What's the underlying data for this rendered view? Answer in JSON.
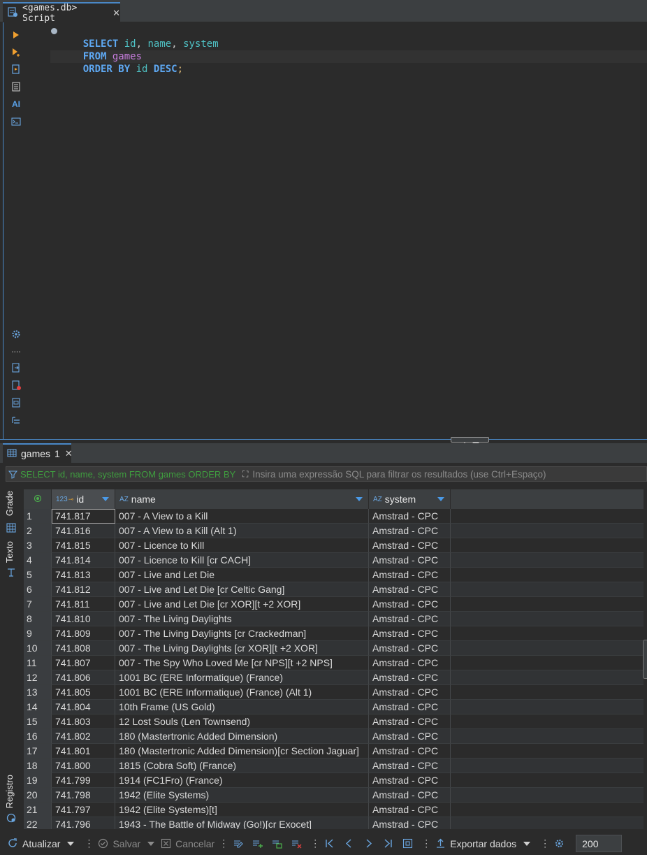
{
  "editor": {
    "tab_label": "<games.db> Script",
    "sql": {
      "line1": {
        "kw1": "SELECT",
        "id": "id",
        "c1": ",",
        "name": "name",
        "c2": ",",
        "system": "system"
      },
      "line2": {
        "kw": "FROM",
        "table": "games"
      },
      "line3": {
        "kw1": "ORDER BY",
        "col": "id",
        "kw2": "DESC",
        "semi": ";"
      }
    },
    "gutter_top_icons": [
      "execute-statement-icon",
      "execute-statement-new-tab-icon",
      "execute-script-icon",
      "explain-plan-icon",
      "ai-assistant-icon",
      "sql-console-icon"
    ],
    "gutter_ai_label": "AI",
    "gutter_bottom_icons": [
      "settings-gear-icon",
      "more-dots-icon",
      "export-script-icon",
      "script-error-icon",
      "sql-file-icon",
      "outline-icon"
    ],
    "gutter_dots": "...."
  },
  "results": {
    "tab_label": "games",
    "tab_count": "1",
    "filter_query": "SELECT id, name, system FROM games ORDER BY id DESC",
    "filter_placeholder": "Insira uma expressão SQL para filtrar os resultados (use Ctrl+Espaço)",
    "side_tabs": {
      "grid": "Grade",
      "text": "Texto",
      "log": "Registro"
    },
    "columns": [
      {
        "type": "123",
        "label": "id"
      },
      {
        "type": "AZ",
        "label": "name"
      },
      {
        "type": "AZ",
        "label": "system"
      }
    ],
    "rows": [
      {
        "n": "1",
        "id": "741.817",
        "name": "007 - A View to a Kill",
        "system": "Amstrad - CPC"
      },
      {
        "n": "2",
        "id": "741.816",
        "name": "007 - A View to a Kill (Alt 1)",
        "system": "Amstrad - CPC"
      },
      {
        "n": "3",
        "id": "741.815",
        "name": "007 - Licence to Kill",
        "system": "Amstrad - CPC"
      },
      {
        "n": "4",
        "id": "741.814",
        "name": "007 - Licence to Kill [cr CACH]",
        "system": "Amstrad - CPC"
      },
      {
        "n": "5",
        "id": "741.813",
        "name": "007 - Live and Let Die",
        "system": "Amstrad - CPC"
      },
      {
        "n": "6",
        "id": "741.812",
        "name": "007 - Live and Let Die [cr Celtic Gang]",
        "system": "Amstrad - CPC"
      },
      {
        "n": "7",
        "id": "741.811",
        "name": "007 - Live and Let Die [cr XOR][t +2 XOR]",
        "system": "Amstrad - CPC"
      },
      {
        "n": "8",
        "id": "741.810",
        "name": "007 - The Living Daylights",
        "system": "Amstrad - CPC"
      },
      {
        "n": "9",
        "id": "741.809",
        "name": "007 - The Living Daylights [cr Crackedman]",
        "system": "Amstrad - CPC"
      },
      {
        "n": "10",
        "id": "741.808",
        "name": "007 - The Living Daylights [cr XOR][t +2 XOR]",
        "system": "Amstrad - CPC"
      },
      {
        "n": "11",
        "id": "741.807",
        "name": "007 - The Spy Who Loved Me [cr NPS][t +2 NPS]",
        "system": "Amstrad - CPC"
      },
      {
        "n": "12",
        "id": "741.806",
        "name": "1001 BC (ERE Informatique) (France)",
        "system": "Amstrad - CPC"
      },
      {
        "n": "13",
        "id": "741.805",
        "name": "1001 BC (ERE Informatique) (France) (Alt 1)",
        "system": "Amstrad - CPC"
      },
      {
        "n": "14",
        "id": "741.804",
        "name": "10th Frame (US Gold)",
        "system": "Amstrad - CPC"
      },
      {
        "n": "15",
        "id": "741.803",
        "name": "12 Lost Souls (Len Townsend)",
        "system": "Amstrad - CPC"
      },
      {
        "n": "16",
        "id": "741.802",
        "name": "180 (Mastertronic Added Dimension)",
        "system": "Amstrad - CPC"
      },
      {
        "n": "17",
        "id": "741.801",
        "name": "180 (Mastertronic Added Dimension)[cr Section Jaguar]",
        "system": "Amstrad - CPC"
      },
      {
        "n": "18",
        "id": "741.800",
        "name": "1815 (Cobra Soft) (France)",
        "system": "Amstrad - CPC"
      },
      {
        "n": "19",
        "id": "741.799",
        "name": "1914 (FC1Fro) (France)",
        "system": "Amstrad - CPC"
      },
      {
        "n": "20",
        "id": "741.798",
        "name": "1942 (Elite Systems)",
        "system": "Amstrad - CPC"
      },
      {
        "n": "21",
        "id": "741.797",
        "name": "1942 (Elite Systems)[t]",
        "system": "Amstrad - CPC"
      },
      {
        "n": "22",
        "id": "741.796",
        "name": "1943 - The Battle of Midway (Go!)[cr Exocet]",
        "system": "Amstrad - CPC"
      }
    ]
  },
  "toolbar": {
    "refresh_label": "Atualizar",
    "save_label": "Salvar",
    "cancel_label": "Cancelar",
    "export_label": "Exportar dados",
    "separator": "⋮",
    "limit_value": "200"
  },
  "colors": {
    "accent": "#4a88c7",
    "keyword": "#5ea8f2",
    "identifier": "#4fc1c4",
    "table": "#c77dde",
    "filter_sql": "#3f9e3f"
  }
}
